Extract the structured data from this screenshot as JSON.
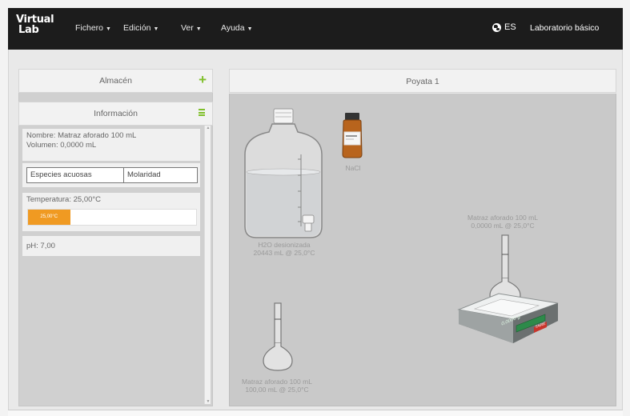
{
  "app": {
    "logo_line1": "Virtual",
    "logo_line2": "Lab"
  },
  "menu": [
    {
      "label": "Fichero"
    },
    {
      "label": "Edición"
    },
    {
      "label": "Ver"
    },
    {
      "label": "Ayuda"
    }
  ],
  "language": "ES",
  "lab_title": "Laboratorio básico",
  "left_panel": {
    "storage_title": "Almacén",
    "info_title": "Información",
    "name_line": "Nombre: Matraz aforado 100 mL",
    "volume_line": "Volumen: 0,0000 mL",
    "species_header": "Especies acuosas",
    "molarity_header": "Molaridad",
    "temperature_line": "Temperatura: 25,00°C",
    "temperature_bar_label": "25,00°C",
    "temperature_fraction": 0.25,
    "ph_line": "pH: 7,00"
  },
  "workspace": {
    "title": "Poyata 1",
    "items": {
      "bottle_caption1": "H2O desionizada",
      "bottle_caption2": "20443 mL @ 25,0°C",
      "jar_label": "NaCl",
      "flask_caption1": "Matraz aforado 100 mL",
      "flask_caption2": "100,00 mL @ 25,0°C",
      "balance_caption1": "Matraz aforado 100 mL",
      "balance_caption2": "0,0000 mL @ 25,0°C",
      "balance_display": "0,0000 g",
      "balance_tare": "TARE"
    }
  },
  "colors": {
    "navbar": "#1c1c1c",
    "accent_green": "#7fbf2a",
    "temperature_orange": "#f09a22",
    "workspace_bg": "#c9c9c9",
    "balance_display": "#2d8a4a"
  }
}
